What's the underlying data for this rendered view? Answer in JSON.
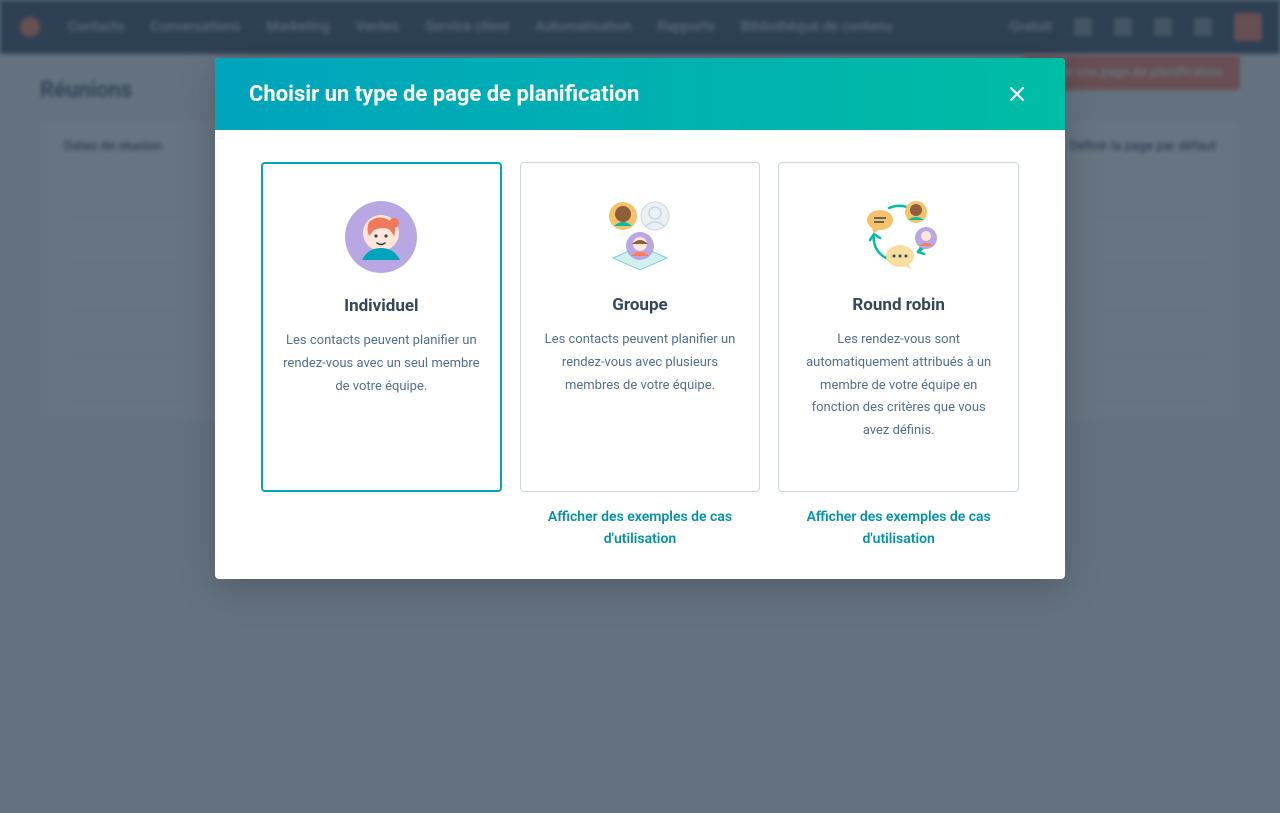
{
  "nav": {
    "items": [
      "Contacts",
      "Conversations",
      "Marketing",
      "Ventes",
      "Service client",
      "Automatisation",
      "Rapports",
      "Bibliothèque de contenu",
      "Gratuit"
    ]
  },
  "page": {
    "title": "Réunions",
    "create_button": "Créer une page de planification",
    "toolbar_left": "Dates de réunion",
    "toolbar_right": "Définir la page par défaut"
  },
  "modal": {
    "title": "Choisir un type de page de planification",
    "cards": [
      {
        "title": "Individuel",
        "desc": "Les contacts peuvent planifier un rendez-vous avec un seul membre de votre équipe."
      },
      {
        "title": "Groupe",
        "desc": "Les contacts peuvent planifier un rendez-vous avec plusieurs membres de votre équipe.",
        "use_cases": "Afficher des exemples de cas d'utilisation"
      },
      {
        "title": "Round robin",
        "desc": "Les rendez-vous sont automatiquement attribués à un membre de votre équipe en fonction des critères que vous avez définis.",
        "use_cases": "Afficher des exemples de cas d'utilisation"
      }
    ]
  }
}
